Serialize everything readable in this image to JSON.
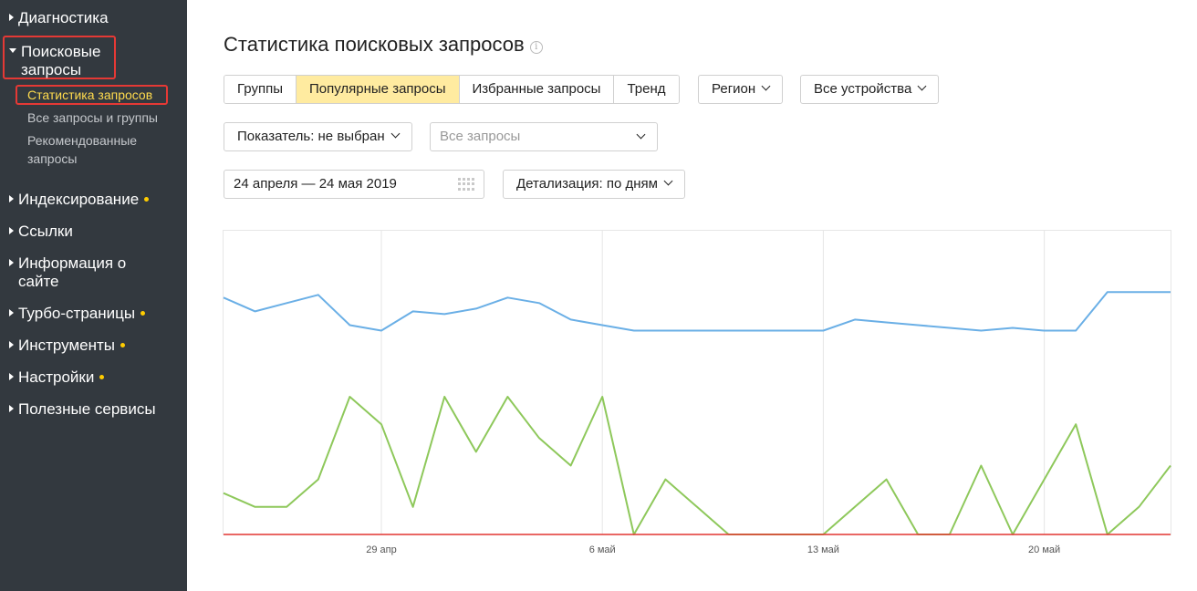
{
  "sidebar": {
    "items": [
      {
        "label": "Диагностика",
        "dot": false
      },
      {
        "label": "Поисковые запросы",
        "dot": false
      },
      {
        "label": "Индексирование",
        "dot": true
      },
      {
        "label": "Ссылки",
        "dot": false
      },
      {
        "label": "Информация о сайте",
        "dot": false
      },
      {
        "label": "Турбо-страницы",
        "dot": true
      },
      {
        "label": "Инструменты",
        "dot": true
      },
      {
        "label": "Настройки",
        "dot": true
      },
      {
        "label": "Полезные сервисы",
        "dot": false
      }
    ],
    "subitems": [
      {
        "label": "Статистика запросов"
      },
      {
        "label": "Все запросы и группы"
      },
      {
        "label": "Рекомендованные запросы"
      }
    ]
  },
  "header": {
    "title": "Статистика поисковых запросов"
  },
  "tabs": [
    {
      "label": "Группы"
    },
    {
      "label": "Популярные запросы"
    },
    {
      "label": "Избранные запросы"
    },
    {
      "label": "Тренд"
    }
  ],
  "filters": {
    "region": "Регион",
    "devices": "Все устройства",
    "metric": "Показатель: не выбран",
    "queries_placeholder": "Все запросы",
    "date_range": "24 апреля — 24 мая 2019",
    "detail": "Детализация: по дням"
  },
  "colors": {
    "accent_tab": "#ffeba0",
    "highlight_border": "#e53935",
    "dot": "#ffcc00",
    "series_1": "#6aafe6",
    "series_2": "#8ec85b",
    "series_3": "#e53935"
  },
  "chart_data": {
    "type": "line",
    "x": [
      "24 апр",
      "25 апр",
      "26 апр",
      "27 апр",
      "28 апр",
      "29 апр",
      "30 апр",
      "1 май",
      "2 май",
      "3 май",
      "4 май",
      "5 май",
      "6 май",
      "7 май",
      "8 май",
      "9 май",
      "10 май",
      "11 май",
      "12 май",
      "13 май",
      "14 май",
      "15 май",
      "16 май",
      "17 май",
      "18 май",
      "19 май",
      "20 май",
      "21 май",
      "22 май",
      "23 май",
      "24 май"
    ],
    "x_tick_labels": [
      "29 апр",
      "6 май",
      "13 май",
      "20 май"
    ],
    "ylim": [
      0,
      100
    ],
    "grid": "vertical",
    "series": [
      {
        "values": [
          86,
          81,
          84,
          87,
          76,
          74,
          81,
          80,
          82,
          86,
          84,
          78,
          76,
          74,
          74,
          74,
          74,
          74,
          74,
          74,
          78,
          77,
          76,
          75,
          74,
          75,
          74,
          74,
          88,
          88,
          88
        ]
      },
      {
        "values": [
          15,
          10,
          10,
          20,
          50,
          40,
          10,
          50,
          30,
          50,
          35,
          25,
          50,
          0,
          20,
          10,
          0,
          0,
          0,
          0,
          10,
          20,
          0,
          0,
          25,
          0,
          20,
          40,
          0,
          10,
          25
        ]
      },
      {
        "values": [
          0,
          0,
          0,
          0,
          0,
          0,
          0,
          0,
          0,
          0,
          0,
          0,
          0,
          0,
          0,
          0,
          0,
          0,
          0,
          0,
          0,
          0,
          0,
          0,
          0,
          0,
          0,
          0,
          0,
          0,
          0
        ]
      }
    ]
  }
}
